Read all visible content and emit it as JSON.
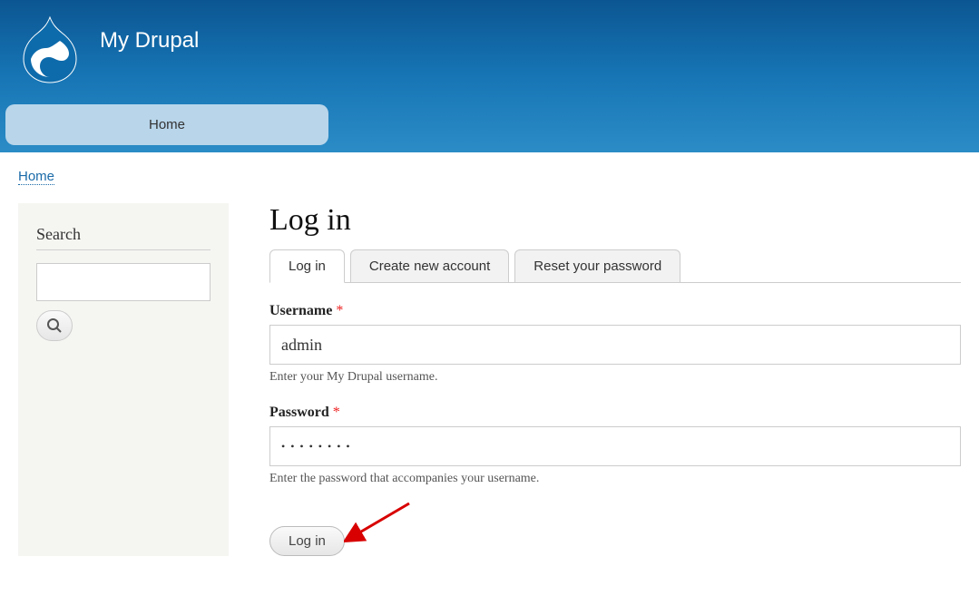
{
  "header": {
    "site_name": "My Drupal"
  },
  "nav": {
    "home": "Home"
  },
  "breadcrumb": {
    "home": "Home"
  },
  "sidebar": {
    "search_title": "Search"
  },
  "main": {
    "title": "Log in",
    "tabs": {
      "login": "Log in",
      "create": "Create new account",
      "reset": "Reset your password"
    },
    "form": {
      "username_label": "Username",
      "username_value": "admin",
      "username_hint": "Enter your My Drupal username.",
      "password_label": "Password",
      "password_value": "••••••••",
      "password_hint": "Enter the password that accompanies your username.",
      "submit_label": "Log in"
    }
  }
}
